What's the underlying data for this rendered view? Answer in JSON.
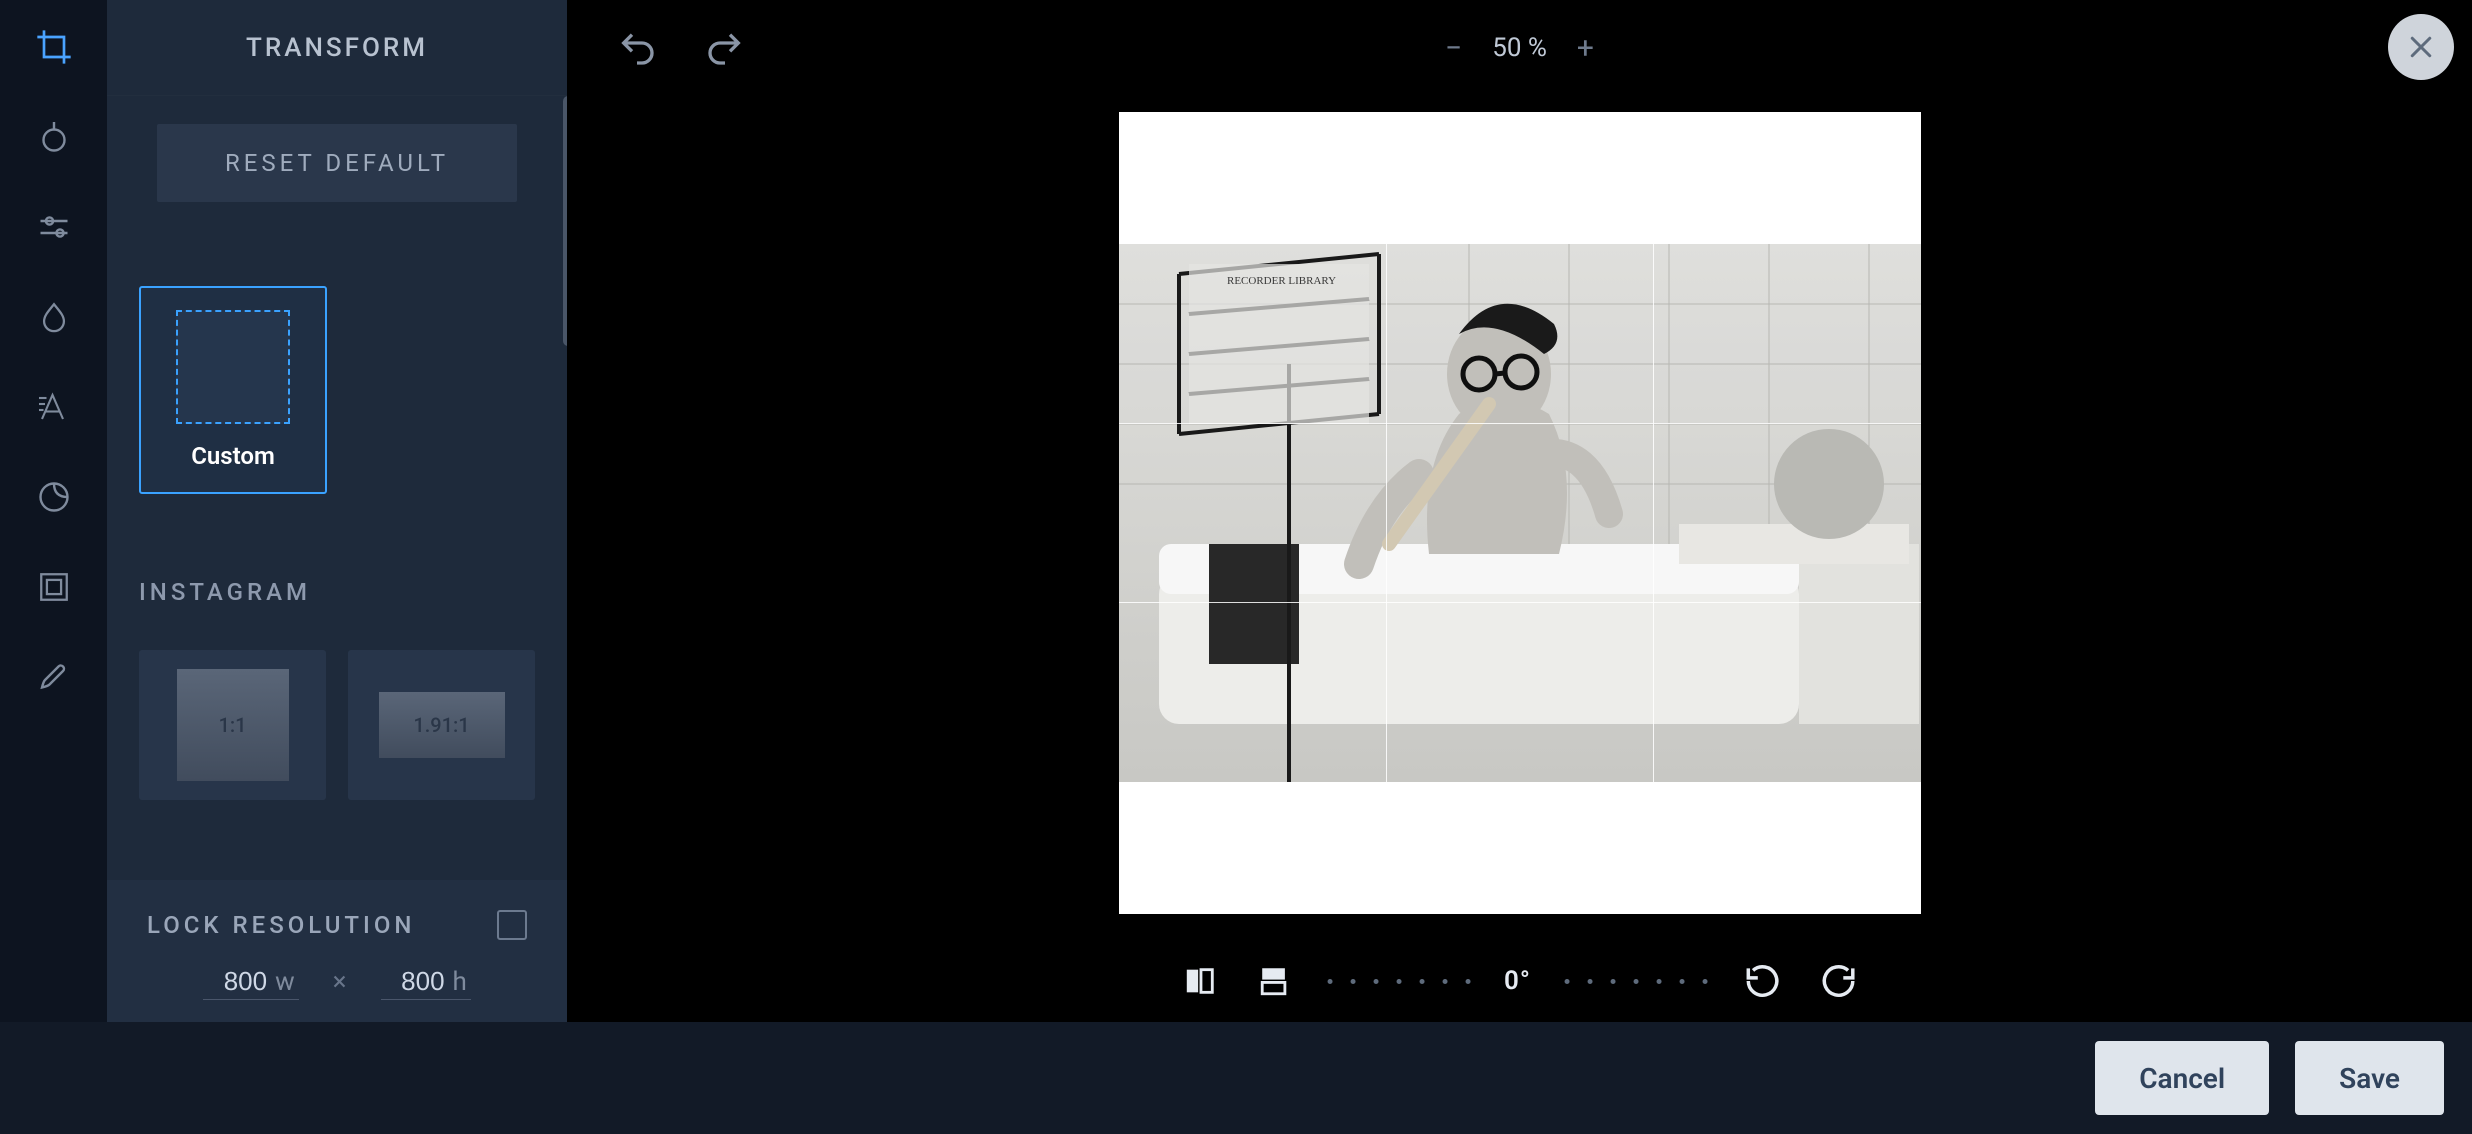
{
  "panel": {
    "title": "TRANSFORM",
    "reset_label": "RESET DEFAULT",
    "preset_custom_label": "Custom",
    "instagram_section": "INSTAGRAM",
    "ig_presets": {
      "square": "1:1",
      "wide": "1.91:1"
    }
  },
  "resolution": {
    "title": "LOCK RESOLUTION",
    "width": "800",
    "height": "800",
    "w_unit": "w",
    "h_unit": "h",
    "times": "×"
  },
  "toolbar": {
    "zoom_minus": "−",
    "zoom_value": "50 %",
    "zoom_plus": "+"
  },
  "rotate": {
    "degrees": "0°"
  },
  "footer": {
    "cancel": "Cancel",
    "save": "Save"
  },
  "rail_icons": [
    "crop",
    "knob",
    "sliders",
    "droplet",
    "text",
    "circle",
    "frame",
    "brush"
  ]
}
